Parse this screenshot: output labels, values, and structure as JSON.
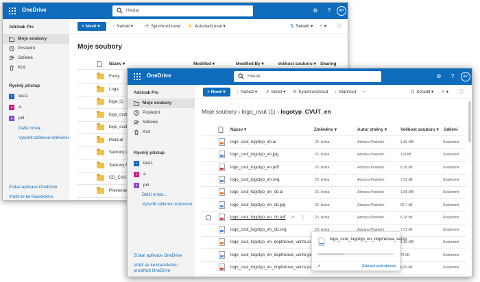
{
  "app_name": "OneDrive",
  "search_placeholder": "Hledat",
  "avatar_initials": "AP",
  "user": "Adrinak Prc",
  "nav": {
    "my_files": "Moje soubory",
    "recent": "Poslední",
    "shared": "Sdílené",
    "recycle": "Koš"
  },
  "quick_access": {
    "title": "Rychlý přístup",
    "items": [
      {
        "label": "test1",
        "color": "#1f66c8"
      },
      {
        "label": "a",
        "color": "#d51d86"
      },
      {
        "label": "pcl",
        "color": "#8c4ad8"
      }
    ],
    "more": "Další místa...",
    "create_library": "Vytvořit sdílenou knihovnu"
  },
  "bottom_links": {
    "get_app": "Získat aplikace OneDrive",
    "classic_back": "Vrátit se ke klasickému prostředí OneDrive"
  },
  "back_window": {
    "commands": {
      "new": "Nové",
      "upload": "Nahrát",
      "sync": "Synchronizovat",
      "automate": "Automatizovat",
      "sort": "Seřadit"
    },
    "title": "Moje soubory",
    "columns": {
      "name": "Název",
      "modified": "Modified",
      "modified_by": "Modified By",
      "size": "Velikost souboru",
      "sharing": "Sharing"
    },
    "folders": [
      "Fonty",
      "Loga",
      "loga (1)",
      "logo_cvut",
      "logo_cvut (1)",
      "Manual",
      "Sablony LO",
      "Sablony MSO",
      "CD_ČVUT_en",
      "Prezentace_A"
    ]
  },
  "front_window": {
    "commands": {
      "new": "Nové",
      "upload": "Nahrát",
      "share": "Sdílet",
      "sync": "Synchronizovat",
      "download": "Stáhnout",
      "sort": "Seřadit"
    },
    "breadcrumb": {
      "root": "Moje soubory",
      "middle": "logo_cvut (1)",
      "current": "logotyp_CVUT_en"
    },
    "columns": {
      "name": "Název",
      "modified": "Změněno",
      "modified_by": "Autor změny",
      "size": "Velikost souboru",
      "sharing": "Sdílení"
    },
    "files": [
      {
        "name": "logo_cvut_logotyp_en.ai",
        "modified": "23. ledna",
        "by": "Adriana Poslední",
        "size": "1,86 MB",
        "sharing": "Soukromé",
        "type": "ai",
        "color": "#e8742a"
      },
      {
        "name": "logo_cvut_logotyp_en.jpg",
        "modified": "23. ledna",
        "by": "Adriana Poslední",
        "size": "110 kB",
        "sharing": "Soukromé",
        "type": "jpg",
        "color": "#5a8fd8"
      },
      {
        "name": "logo_cvut_logotyp_en.pdf",
        "modified": "23. ledna",
        "by": "Adriana Poslední",
        "size": "6,18 kB",
        "sharing": "Soukromé",
        "type": "pdf",
        "color": "#d33d3d"
      },
      {
        "name": "logo_cvut_logotyp_en.svg",
        "modified": "23. ledna",
        "by": "Adriana Poslední",
        "size": "7,32 kB",
        "sharing": "Soukromé",
        "type": "svg",
        "color": "#5a8fd8"
      },
      {
        "name": "logo_cvut_logotyp_en_cb.ai",
        "modified": "23. ledna",
        "by": "Adriana Poslední",
        "size": "1,88 MB",
        "sharing": "Soukromé",
        "type": "ai",
        "color": "#e8742a"
      },
      {
        "name": "logo_cvut_logotyp_en_cb.jpg",
        "modified": "23. ledna",
        "by": "Adriana Poslední",
        "size": "65,7 kB",
        "sharing": "Soukromé",
        "type": "jpg",
        "color": "#5a8fd8"
      },
      {
        "name": "logo_cvut_logotyp_en_cb.pdf",
        "modified": "23. ledna",
        "by": "Adriana Poslední",
        "size": "6,18 kB",
        "sharing": "Soukromé",
        "type": "pdf",
        "color": "#d33d3d"
      },
      {
        "name": "logo_cvut_logotyp_en_cb.svg",
        "modified": "23. ledna",
        "by": "Adriana Poslední",
        "size": "7,31 kB",
        "sharing": "Soukromé",
        "type": "svg",
        "color": "#5a8fd8"
      },
      {
        "name": "logo_cvut_logotyp_en_doplnkova_verze.ai",
        "modified": "23. ledna",
        "by": "Adriana Poslední",
        "size": "1,85 MB",
        "sharing": "Soukromé",
        "type": "ai",
        "color": "#e8742a"
      },
      {
        "name": "logo_cvut_logotyp_en_doplnkova_verze.jpg",
        "modified": "23. ledna",
        "by": "Adriana Poslední",
        "size": "79 kB",
        "sharing": "Soukromé",
        "type": "jpg",
        "color": "#5a8fd8"
      },
      {
        "name": "logo_cvut_logotyp_en_doplnkova_verze.pdf",
        "modified": "23. ledna",
        "by": "Adriana Poslední",
        "size": "6,09 kB",
        "sharing": "Soukromé",
        "type": "pdf",
        "color": "#d33d3d"
      }
    ],
    "selected_row": 6,
    "popup": {
      "file_name": "logo_cvut_logotyp_en_doplnkova_verze",
      "link": "Zobrazit podrobnosti",
      "progress": 0.35
    }
  },
  "accent": "#0f6cbd"
}
